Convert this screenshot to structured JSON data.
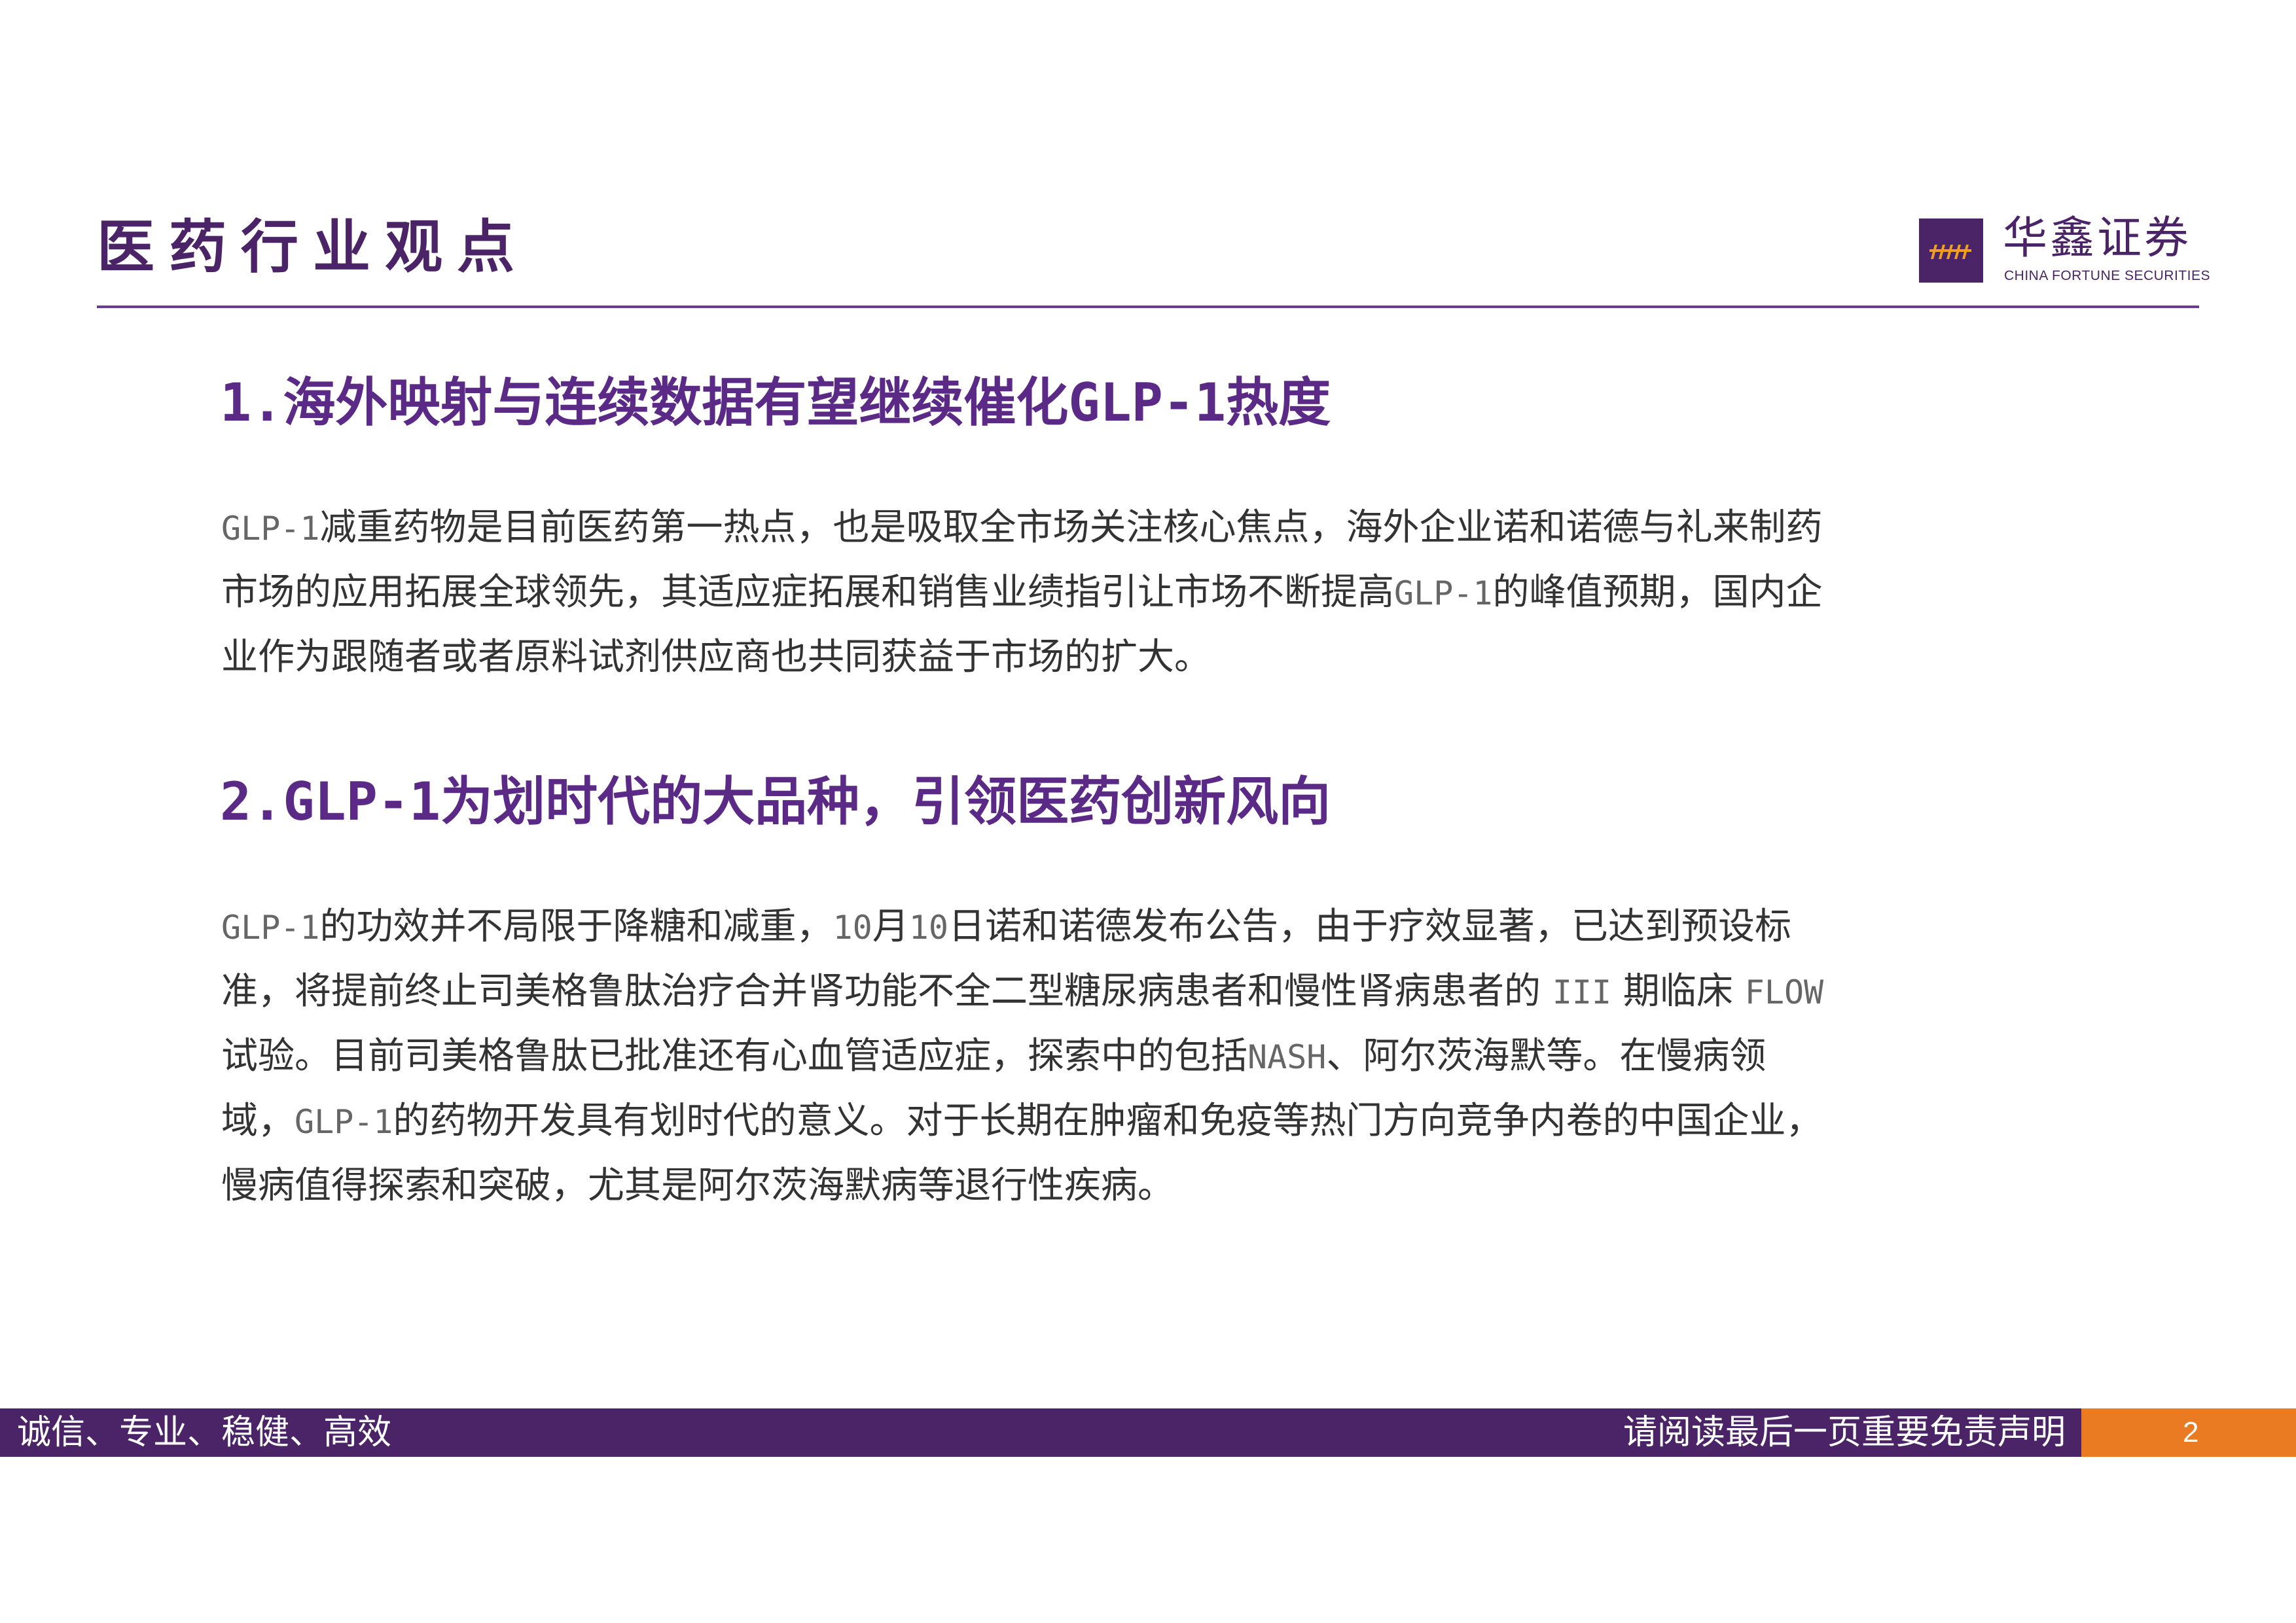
{
  "header": {
    "title": "医药行业观点",
    "logo": {
      "cn": "华鑫证券",
      "en": "CHINA FORTUNE SECURITIES",
      "icon": "chinafortune-logo-icon"
    }
  },
  "sections": [
    {
      "num": "1.",
      "title_a": "海外映射与连续数据有望继续催化",
      "title_mono": "GLP-1",
      "title_b": "热度",
      "paragraph": [
        {
          "t": "GLP-1",
          "m": true
        },
        {
          "t": "减重药物是目前医药第一热点，也是吸取全市场关注核心焦点，海外企业诺和诺德与礼来制药市场的应用拓展全球领先，其适应症拓展和销售业绩指引让市场不断提高"
        },
        {
          "t": "GLP-1",
          "m": true
        },
        {
          "t": "的峰值预期，国内企业作为跟随者或者原料试剂供应商也共同获益于市场的扩大。"
        }
      ]
    },
    {
      "num": "2.",
      "title_a": "",
      "title_mono": "GLP-1",
      "title_b": "为划时代的大品种，引领医药创新风向",
      "paragraph": [
        {
          "t": "GLP-1",
          "m": true
        },
        {
          "t": "的功效并不局限于降糖和减重，"
        },
        {
          "t": "10",
          "m": true
        },
        {
          "t": "月"
        },
        {
          "t": "10",
          "m": true
        },
        {
          "t": "日诺和诺德发布公告，由于疗效显著，已达到预设标准，将提前终止司美格鲁肽治疗合并肾功能不全二型糖尿病患者和慢性肾病患者的 "
        },
        {
          "t": "III",
          "m": true
        },
        {
          "t": " 期临床 "
        },
        {
          "t": "FLOW",
          "m": true
        },
        {
          "t": " 试验。目前司美格鲁肽已批准还有心血管适应症，探索中的包括"
        },
        {
          "t": "NASH",
          "m": true
        },
        {
          "t": "、阿尔茨海默等。在慢病领域，"
        },
        {
          "t": "GLP-1",
          "m": true
        },
        {
          "t": "的药物开发具有划时代的意义。对于长期在肿瘤和免疫等热门方向竞争内卷的中国企业，慢病值得探索和突破，尤其是阿尔茨海默病等退行性疾病。"
        }
      ]
    }
  ],
  "footer": {
    "slogan": "诚信、专业、稳健、高效",
    "disclaimer": "请阅读最后一页重要免责声明",
    "page": "2"
  },
  "colors": {
    "brand_purple": "#4b2367",
    "heading_purple": "#5b2a86",
    "accent_orange": "#ea7b22",
    "body_text": "#333333"
  }
}
